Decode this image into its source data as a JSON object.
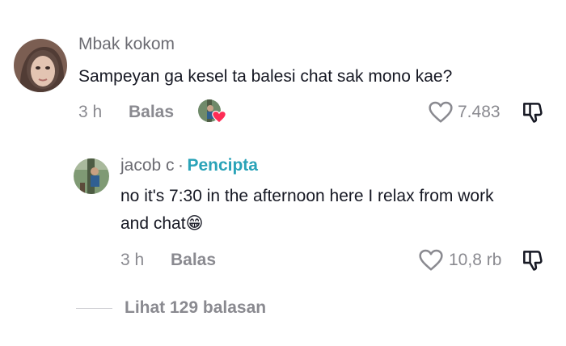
{
  "comment": {
    "username": "Mbak kokom",
    "text": "Sampeyan ga kesel ta balesi chat sak mono kae?",
    "time": "3 h",
    "reply_label": "Balas",
    "likes": "7.483"
  },
  "reply": {
    "username": "jacob c",
    "separator": "·",
    "creator_label": "Pencipta",
    "text_line1": "no it's 7:30 in the afternoon here I relax from work",
    "text_line2": "and chat",
    "emoji": "😁",
    "time": "3 h",
    "reply_label": "Balas",
    "likes": "10,8 rb"
  },
  "view_replies": {
    "label": "Lihat 129 balasan"
  },
  "colors": {
    "creator_accent": "#2aa3b8",
    "liked_heart": "#fe2c55",
    "muted_text": "#8a8a90"
  }
}
